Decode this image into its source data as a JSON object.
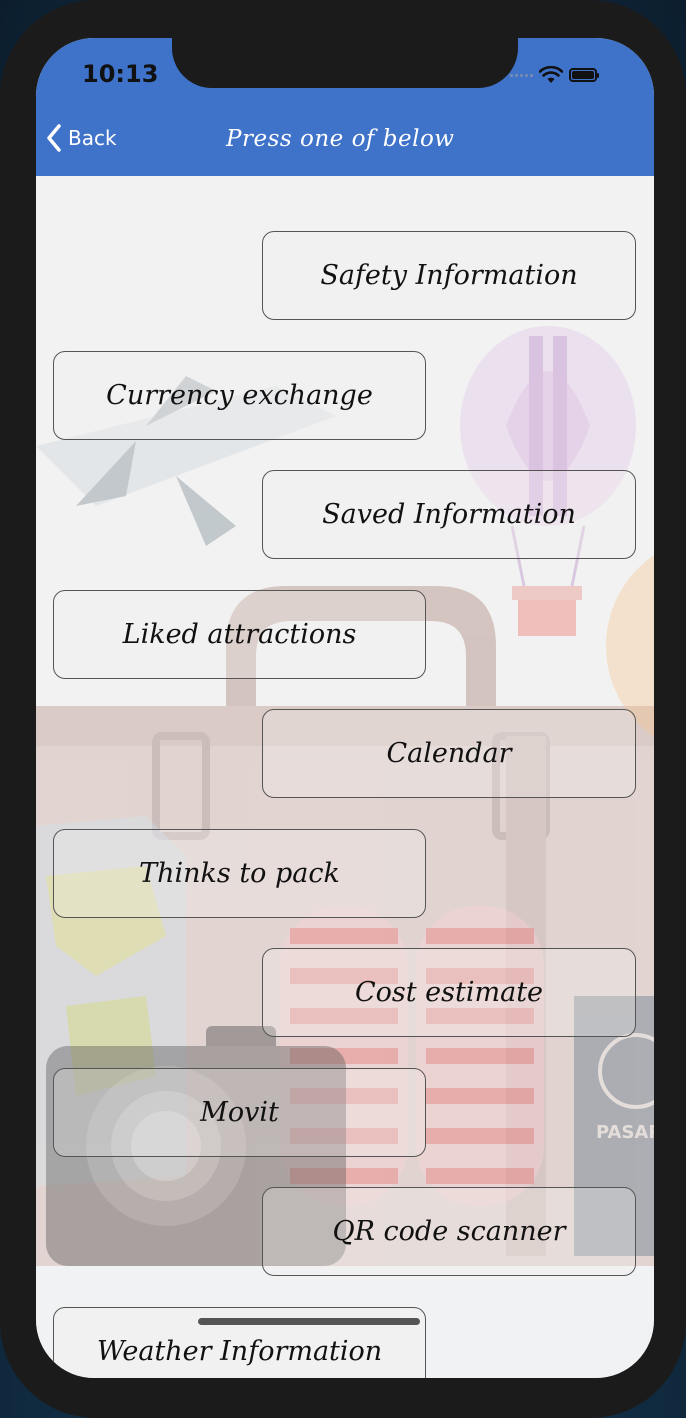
{
  "status_bar": {
    "time": "10:13",
    "icons": [
      "signal-icon",
      "wifi-icon",
      "battery-icon"
    ]
  },
  "navbar": {
    "back_label": "Back",
    "title": "Press one of below",
    "color": "#3f72c9"
  },
  "menu": {
    "items": [
      {
        "label": "Safety Information",
        "side": "right"
      },
      {
        "label": "Currency exchange",
        "side": "left"
      },
      {
        "label": "Saved Information",
        "side": "right"
      },
      {
        "label": "Liked attractions",
        "side": "left"
      },
      {
        "label": "Calendar",
        "side": "right"
      },
      {
        "label": "Thinks to pack",
        "side": "left"
      },
      {
        "label": "Cost estimate",
        "side": "right"
      },
      {
        "label": "Movit",
        "side": "left"
      },
      {
        "label": "QR code scanner",
        "side": "right"
      },
      {
        "label": "Weather Information",
        "side": "left"
      }
    ]
  },
  "background": {
    "passport_text": "PASAP"
  }
}
